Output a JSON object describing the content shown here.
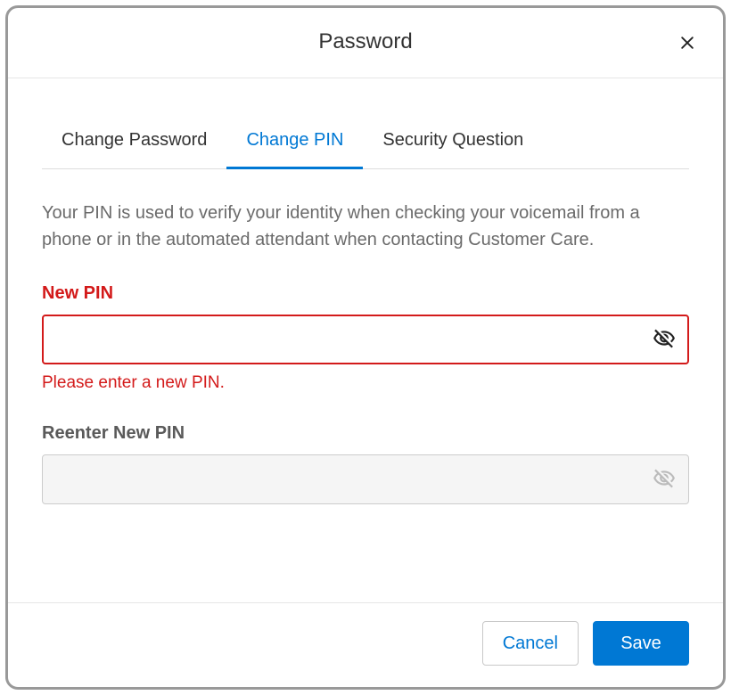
{
  "dialog": {
    "title": "Password"
  },
  "tabs": [
    {
      "label": "Change Password",
      "active": false
    },
    {
      "label": "Change PIN",
      "active": true
    },
    {
      "label": "Security Question",
      "active": false
    }
  ],
  "description": "Your PIN is used to verify your identity when checking your voicemail from a phone or in the automated attendant when contacting Customer Care.",
  "fields": {
    "newPin": {
      "label": "New PIN",
      "value": "",
      "error": "Please enter a new PIN."
    },
    "reenterPin": {
      "label": "Reenter New PIN",
      "value": ""
    }
  },
  "buttons": {
    "cancel": "Cancel",
    "save": "Save"
  }
}
